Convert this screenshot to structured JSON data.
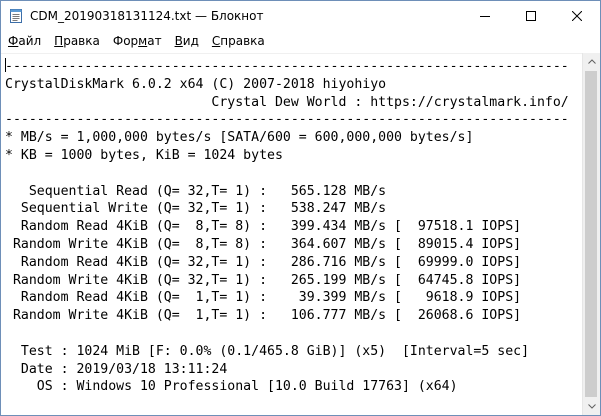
{
  "window": {
    "title": "CDM_20190318131124.txt — Блокнот"
  },
  "menu": {
    "file_accel": "Ф",
    "file_rest": "айл",
    "edit_accel": "П",
    "edit_rest": "равка",
    "format_pre": "Фор",
    "format_accel": "м",
    "format_rest": "ат",
    "view_accel": "В",
    "view_rest": "ид",
    "help_accel": "С",
    "help_rest": "правка"
  },
  "document": {
    "line01": "-----------------------------------------------------------------------",
    "line02": "CrystalDiskMark 6.0.2 x64 (C) 2007-2018 hiyohiyo",
    "line03": "                          Crystal Dew World : https://crystalmark.info/",
    "line04": "-----------------------------------------------------------------------",
    "line05": "* MB/s = 1,000,000 bytes/s [SATA/600 = 600,000,000 bytes/s]",
    "line06": "* KB = 1000 bytes, KiB = 1024 bytes",
    "line07": "",
    "line08": "   Sequential Read (Q= 32,T= 1) :   565.128 MB/s",
    "line09": "  Sequential Write (Q= 32,T= 1) :   538.247 MB/s",
    "line10": "  Random Read 4KiB (Q=  8,T= 8) :   399.434 MB/s [  97518.1 IOPS]",
    "line11": " Random Write 4KiB (Q=  8,T= 8) :   364.607 MB/s [  89015.4 IOPS]",
    "line12": "  Random Read 4KiB (Q= 32,T= 1) :   286.716 MB/s [  69999.0 IOPS]",
    "line13": " Random Write 4KiB (Q= 32,T= 1) :   265.199 MB/s [  64745.8 IOPS]",
    "line14": "  Random Read 4KiB (Q=  1,T= 1) :    39.399 MB/s [   9618.9 IOPS]",
    "line15": " Random Write 4KiB (Q=  1,T= 1) :   106.777 MB/s [  26068.6 IOPS]",
    "line16": "",
    "line17": "  Test : 1024 MiB [F: 0.0% (0.1/465.8 GiB)] (x5)  [Interval=5 sec]",
    "line18": "  Date : 2019/03/18 13:11:24",
    "line19": "    OS : Windows 10 Professional [10.0 Build 17763] (x64)"
  }
}
